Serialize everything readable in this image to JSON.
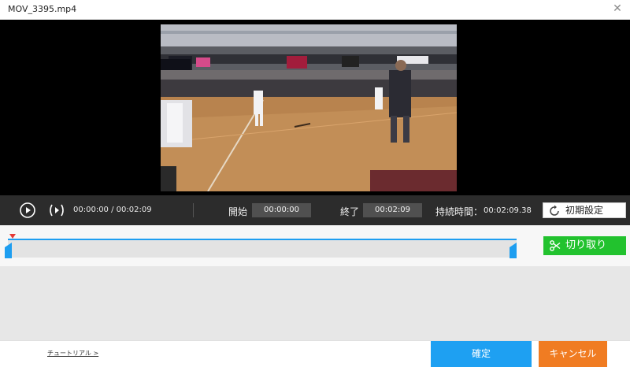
{
  "window": {
    "title": "MOV_3395.mp4",
    "close_icon": "close-icon"
  },
  "player": {
    "time_current": "00:00:00",
    "time_separator": "/",
    "time_total": "00:02:09"
  },
  "trim": {
    "start_label": "開始",
    "start_value": "00:00:00",
    "end_label": "終了",
    "end_value": "00:02:09",
    "duration_label": "持続時間：",
    "duration_value": "00:02:09.38",
    "reset_label": "初期設定",
    "cut_label": "切り取り"
  },
  "footer": {
    "tutorial_link": "チュートリアル >",
    "confirm_label": "確定",
    "cancel_label": "キャンセル"
  },
  "colors": {
    "accent_blue": "#1ea0f2",
    "cut_green": "#22c22e",
    "cancel_orange": "#f07c22",
    "playhead_red": "#e53935"
  }
}
